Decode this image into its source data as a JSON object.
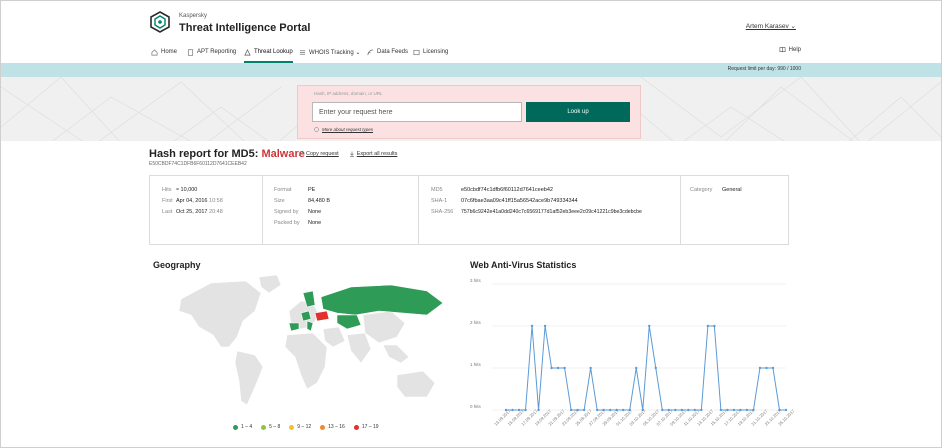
{
  "app": {
    "brand_small": "Kaspersky",
    "brand_title": "Threat Intelligence Portal",
    "user": "Artem Karasev ⌄"
  },
  "nav": {
    "items": [
      {
        "label": "Home",
        "icon": "home-icon"
      },
      {
        "label": "APT Reporting",
        "icon": "document-icon"
      },
      {
        "label": "Threat Lookup",
        "icon": "hazard-icon"
      },
      {
        "label": "WHOIS Tracking ⌄",
        "icon": "list-icon"
      },
      {
        "label": "Data Feeds",
        "icon": "feed-icon"
      },
      {
        "label": "Licensing",
        "icon": "license-icon"
      }
    ],
    "active": "Threat Lookup",
    "help": "Help"
  },
  "limit_text": "Request limit per day: 990 / 1000",
  "search": {
    "hint": "Hash, IP address, domain, or URL",
    "placeholder": "Enter your request here",
    "button": "Look up",
    "request_types": "More about request types"
  },
  "report": {
    "title_prefix": "Hash report for MD5:",
    "verdict": "Malware",
    "hash": "E50CBDF74C1DFB6F60112D7641CEEB42",
    "links": {
      "copy": "Copy request",
      "export": "Export all results"
    },
    "hits": {
      "label": "Hits",
      "value": "≈ 10,000"
    },
    "first": {
      "label": "First",
      "value": "Apr 04, 2016",
      "time": "10:58"
    },
    "last": {
      "label": "Last",
      "value": "Oct 25, 2017",
      "time": "20:48"
    },
    "format": {
      "label": "Format",
      "value": "PE"
    },
    "size": {
      "label": "Size",
      "value": "84,480 B"
    },
    "signed": {
      "label": "Signed by",
      "value": "None"
    },
    "packed": {
      "label": "Packed by",
      "value": "None"
    },
    "md5": {
      "label": "MD5",
      "value": "e50cbdf74c1dfb6f60112d7641ceeb42"
    },
    "sha1": {
      "label": "SHA-1",
      "value": "07c6fbae3aa09c41ff15a56542ace9b749334344"
    },
    "sha256": {
      "label": "SHA-256",
      "value": "757b6c9242e41a0dd240c7c6569177d1af52eb3eee2c09c41221c9be3cdebcbe"
    },
    "category": {
      "label": "Category",
      "value": "General"
    }
  },
  "geo": {
    "title": "Geography",
    "legend": [
      {
        "label": "1 – 4",
        "color": "#2e9b56"
      },
      {
        "label": "5 – 8",
        "color": "#8dc63f"
      },
      {
        "label": "9 – 12",
        "color": "#f2c12e"
      },
      {
        "label": "13 – 16",
        "color": "#ef8a2d"
      },
      {
        "label": "17 – 19",
        "color": "#e2322c"
      }
    ]
  },
  "stats": {
    "title": "Web Anti-Virus Statistics"
  },
  "chart_data": {
    "type": "line",
    "title": "Web Anti-Virus Statistics",
    "ylim": [
      0,
      3
    ],
    "y_ticks": [
      "0 hits",
      "1 hits",
      "2 hits",
      "3 hits"
    ],
    "x": [
      "13.09.2017",
      "15.09.2017",
      "17.09.2017",
      "19.09.2017",
      "21.09.2017",
      "23.09.2017",
      "25.09.2017",
      "27.09.2017",
      "29.09.2017",
      "01.10.2017",
      "03.10.2017",
      "05.10.2017",
      "07.10.2017",
      "09.10.2017",
      "11.10.2017",
      "13.10.2017",
      "15.10.2017",
      "17.10.2017",
      "19.10.2017",
      "21.10.2017",
      "23.10.2017",
      "25.10.2017"
    ],
    "series": [
      {
        "values": [
          0,
          0,
          0,
          0,
          2,
          0,
          2,
          1,
          1,
          1,
          0,
          0,
          0,
          1,
          0,
          0,
          0,
          0,
          0,
          0,
          1,
          0,
          2,
          1,
          0,
          0,
          0,
          0,
          0,
          0,
          0,
          2,
          2,
          0,
          0,
          0,
          0,
          0,
          0,
          1,
          1,
          1,
          0,
          0
        ],
        "color": "#5b9bd5"
      }
    ],
    "grid": true
  }
}
